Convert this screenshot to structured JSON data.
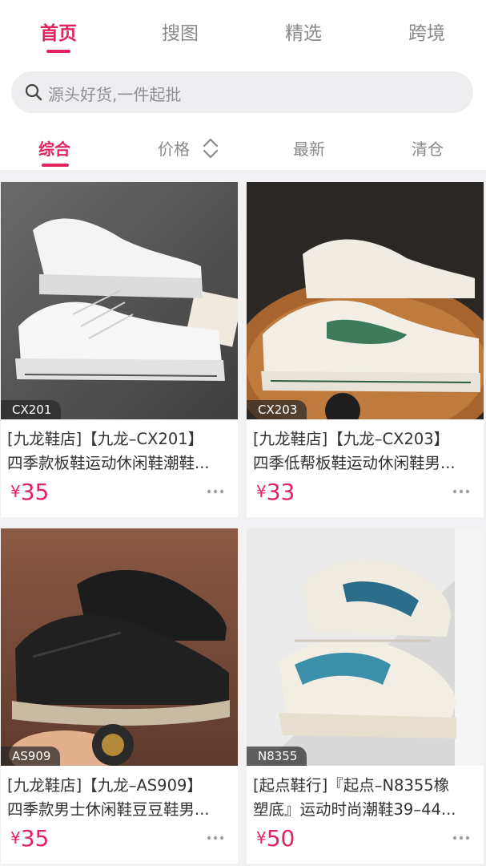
{
  "top_tabs": [
    "首页",
    "搜图",
    "精选",
    "跨境"
  ],
  "search": {
    "placeholder": "源头好货,一件起批"
  },
  "sort_tabs": [
    "综合",
    "价格",
    "最新",
    "清仓"
  ],
  "products": [
    {
      "code": "CX201",
      "title_line1": "[九龙鞋店]【九龙–CX201】",
      "title_line2": "四季款板鞋运动休闲鞋潮鞋...",
      "currency": "¥",
      "price": "35"
    },
    {
      "code": "CX203",
      "title_line1": "[九龙鞋店]【九龙–CX203】",
      "title_line2": "四季低帮板鞋运动休闲鞋男...",
      "currency": "¥",
      "price": "33"
    },
    {
      "code": "AS909",
      "title_line1": "[九龙鞋店]【九龙–AS909】",
      "title_line2": "四季款男士休闲鞋豆豆鞋男...",
      "currency": "¥",
      "price": "35"
    },
    {
      "code": "N8355",
      "title_line1": "[起点鞋行]『起点–N8355橡",
      "title_line2": "塑底』运动时尚潮鞋39–44...",
      "currency": "¥",
      "price": "50"
    }
  ],
  "colors": {
    "accent": "#e0245e",
    "muted": "#8a8a8e",
    "background": "#f2f2f4"
  }
}
